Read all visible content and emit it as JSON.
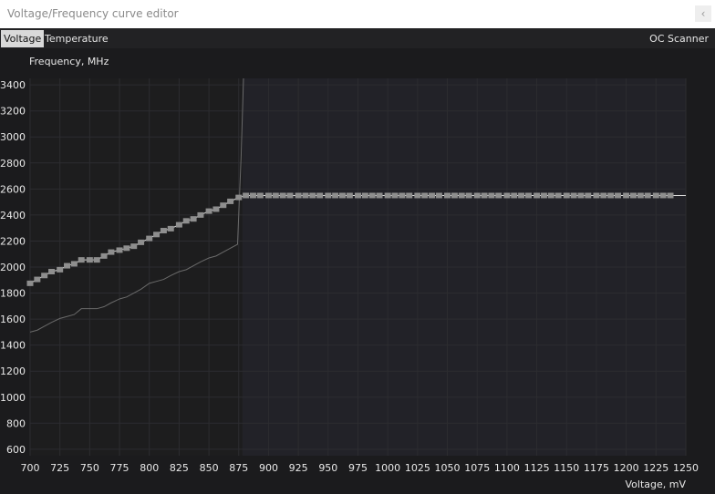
{
  "window": {
    "title": "Voltage/Frequency curve editor",
    "close_glyph": "‹"
  },
  "tabs": [
    {
      "label": "Voltage",
      "active": true
    },
    {
      "label": "Temperature",
      "active": false
    }
  ],
  "oc_scanner_label": "OC Scanner",
  "colors": {
    "plot_left_bg": "#1d1d1e",
    "plot_right_bg": "#222228",
    "grid": "#2c2c30",
    "curve": "#d8d8d8",
    "point": "#8e8e8e",
    "base_curve": "#6a6a6a",
    "tick_text": "#e8e8e8"
  },
  "chart_data": {
    "type": "line",
    "ylabel": "Frequency, MHz",
    "xlabel": "Voltage, mV",
    "xlim": [
      700,
      1250
    ],
    "ylim": [
      550,
      3450
    ],
    "x_ticks": [
      700,
      725,
      750,
      775,
      800,
      825,
      850,
      875,
      900,
      925,
      950,
      975,
      1000,
      1025,
      1050,
      1075,
      1100,
      1125,
      1150,
      1175,
      1200,
      1225,
      1250
    ],
    "y_ticks": [
      600,
      800,
      1000,
      1200,
      1400,
      1600,
      1800,
      2000,
      2200,
      2400,
      2600,
      2800,
      3000,
      3200,
      3400
    ],
    "highlight_x_max": 878,
    "series": [
      {
        "role": "edited-curve",
        "points_x": [
          700,
          706,
          712,
          718,
          725,
          731,
          737,
          743,
          750,
          756,
          762,
          768,
          775,
          781,
          787,
          793,
          800,
          806,
          812,
          818,
          825,
          831,
          837,
          843,
          850,
          856,
          862,
          868,
          875,
          881,
          887,
          893,
          900,
          906,
          912,
          918,
          925,
          931,
          937,
          943,
          950,
          956,
          962,
          968,
          975,
          981,
          987,
          993,
          1000,
          1006,
          1012,
          1018,
          1025,
          1031,
          1037,
          1043,
          1050,
          1056,
          1062,
          1068,
          1075,
          1081,
          1087,
          1093,
          1100,
          1106,
          1112,
          1118,
          1125,
          1131,
          1137,
          1143,
          1150,
          1156,
          1162,
          1168,
          1175,
          1181,
          1187,
          1193,
          1200,
          1206,
          1212,
          1218,
          1225,
          1231,
          1237
        ],
        "points_y": [
          1875,
          1905,
          1935,
          1965,
          1980,
          2010,
          2025,
          2055,
          2055,
          2055,
          2085,
          2115,
          2130,
          2145,
          2160,
          2190,
          2220,
          2250,
          2280,
          2295,
          2325,
          2355,
          2370,
          2400,
          2430,
          2445,
          2475,
          2505,
          2535,
          2550,
          2550,
          2550,
          2550,
          2550,
          2550,
          2550,
          2550,
          2550,
          2550,
          2550,
          2550,
          2550,
          2550,
          2550,
          2550,
          2550,
          2550,
          2550,
          2550,
          2550,
          2550,
          2550,
          2550,
          2550,
          2550,
          2550,
          2550,
          2550,
          2550,
          2550,
          2550,
          2550,
          2550,
          2550,
          2550,
          2550,
          2550,
          2550,
          2550,
          2550,
          2550,
          2550,
          2550,
          2550,
          2550,
          2550,
          2550,
          2550,
          2550,
          2550,
          2550,
          2550,
          2550,
          2550,
          2550,
          2550,
          2550
        ],
        "line_end_x": 1250
      },
      {
        "role": "base-curve",
        "x": [
          700,
          706,
          712,
          718,
          725,
          731,
          737,
          743,
          750,
          756,
          762,
          768,
          775,
          781,
          787,
          793,
          800,
          806,
          812,
          818,
          825,
          831,
          837,
          843,
          850,
          856,
          862,
          868,
          874,
          877,
          879
        ],
        "y": [
          1500,
          1515,
          1545,
          1575,
          1605,
          1620,
          1635,
          1680,
          1680,
          1680,
          1695,
          1725,
          1755,
          1770,
          1800,
          1830,
          1875,
          1890,
          1905,
          1935,
          1965,
          1980,
          2010,
          2040,
          2070,
          2085,
          2115,
          2145,
          2175,
          2850,
          3450
        ]
      }
    ]
  }
}
